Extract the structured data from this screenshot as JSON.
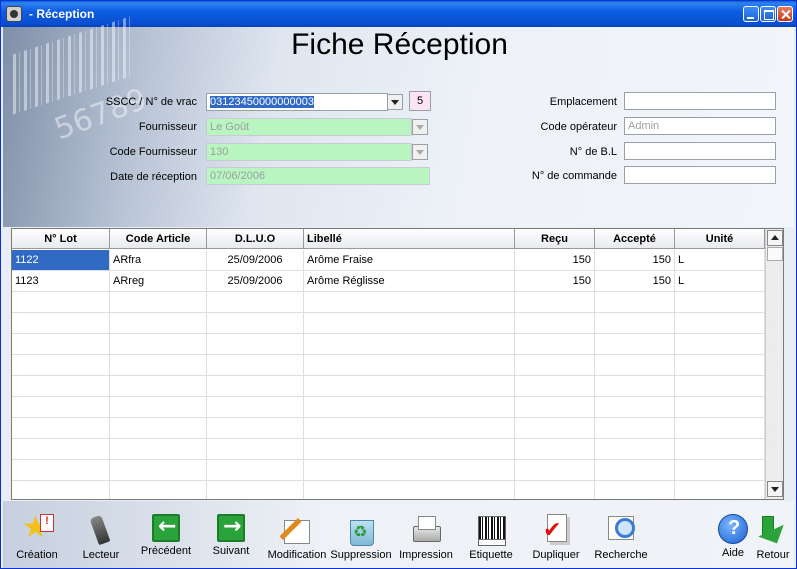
{
  "window": {
    "title": "- Réception"
  },
  "page": {
    "title": "Fiche Réception"
  },
  "form": {
    "sscc": {
      "label": "SSCC / N° de vrac",
      "value": "03123450000000003",
      "count": "5"
    },
    "fournisseur": {
      "label": "Fournisseur",
      "value": "Le Goût"
    },
    "code_fournisseur": {
      "label": "Code Fournisseur",
      "value": "130"
    },
    "date_reception": {
      "label": "Date de réception",
      "value": "07/06/2006"
    },
    "emplacement": {
      "label": "Emplacement",
      "value": ""
    },
    "code_operateur": {
      "label": "Code opérateur",
      "value": "Admin"
    },
    "num_bl": {
      "label": "N° de B.L",
      "value": ""
    },
    "num_commande": {
      "label": "N° de commande",
      "value": ""
    }
  },
  "grid": {
    "columns": [
      "N° Lot",
      "Code Article",
      "D.L.U.O",
      "Libellé",
      "Reçu",
      "Accepté",
      "Unité"
    ],
    "rows": [
      {
        "lot": "1122",
        "code": "ARfra",
        "dluo": "25/09/2006",
        "libelle": "Arôme Fraise",
        "recu": "150",
        "accepte": "150",
        "unite": "L"
      },
      {
        "lot": "1123",
        "code": "ARreg",
        "dluo": "25/09/2006",
        "libelle": "Arôme Réglisse",
        "recu": "150",
        "accepte": "150",
        "unite": "L"
      }
    ],
    "empty_rows": 10
  },
  "toolbar": {
    "creation": "Création",
    "lecteur": "Lecteur",
    "precedent": "Précédent",
    "suivant": "Suivant",
    "modification": "Modification",
    "suppression": "Suppression",
    "impression": "Impression",
    "etiquette": "Etiquette",
    "dupliquer": "Dupliquer",
    "recherche": "Recherche",
    "aide": "Aide",
    "retour": "Retour"
  },
  "colors": {
    "selection": "#316ac5",
    "green_field": "#b9f5c1",
    "titlebar": "#0a4fd1"
  }
}
